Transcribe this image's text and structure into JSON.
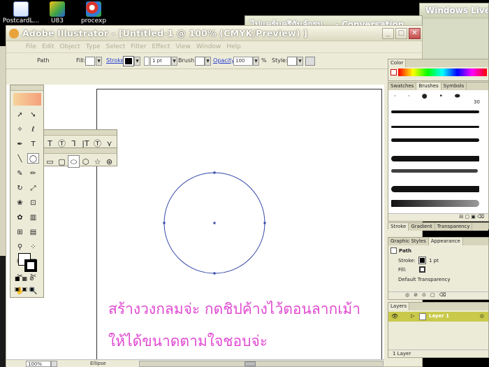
{
  "desktop": {
    "icons": [
      {
        "label": "PostcardL..."
      },
      {
        "label": "U83"
      },
      {
        "label": "procexp"
      }
    ]
  },
  "background_windows": {
    "conversation_title": "ไปแคร์นครีกันล์กรม... - Conversation",
    "windows_live_title": "Windows Live"
  },
  "illustrator": {
    "title": "Adobe Illustrator - [Untitled-1 @ 100% (CMYK/Preview) ]",
    "menu": [
      "File",
      "Edit",
      "Object",
      "Type",
      "Select",
      "Filter",
      "Effect",
      "View",
      "Window",
      "Help"
    ],
    "control_bar": {
      "path_label": "Path",
      "fill_label": "Fill:",
      "stroke_label": "Stroke:",
      "stroke_weight": "1 pt",
      "brush_label": "Brush:",
      "opacity_label": "Opacity:",
      "opacity_value": "100",
      "percent": "%",
      "style_label": "Style:"
    },
    "status_bar": {
      "zoom": "100%",
      "current_tool": "Ellipse"
    },
    "annotation_line1": "สร้างวงกลมจ่ะ กดชิปค้างไว้ตอนลากเม้า",
    "annotation_line2": "ให้ได้ขนาดตามใจชอบจ่ะ"
  },
  "panels": {
    "color": {
      "title": "Color"
    },
    "swatches_tabs": [
      "Swatches",
      "Brushes",
      "Symbols"
    ],
    "brush_size_label": "30",
    "stroke_tabs": [
      "Stroke",
      "Gradient",
      "Transparency"
    ],
    "appearance_tabs": [
      "Graphic Styles",
      "Appearance"
    ],
    "appearance": {
      "header": "Path",
      "stroke_label": "Stroke:",
      "stroke_value": "1 pt",
      "fill_label": "Fill:",
      "transparency": "Default Transparency"
    },
    "layers": {
      "title": "Layers",
      "layer_name": "Layer 1",
      "footer": "1 Layer"
    }
  },
  "colors": {
    "annotation": "#e04ad1",
    "circle_stroke": "#3346a6",
    "layer_highlight": "#c9c94a"
  }
}
